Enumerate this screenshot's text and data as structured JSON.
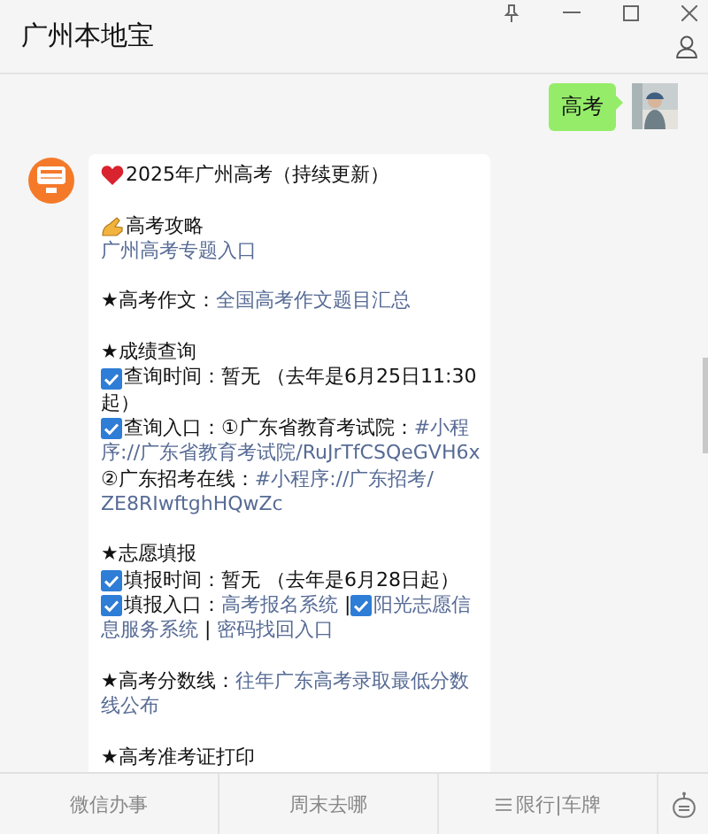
{
  "window": {
    "title": "广州本地宝"
  },
  "outgoing": {
    "text": "高考"
  },
  "incoming": {
    "lines": [
      {
        "space_before": false,
        "parts": [
          {
            "kind": "heart"
          },
          {
            "kind": "text",
            "text": "2025年广州高考（持续更新）"
          }
        ]
      },
      {
        "space_before": true,
        "parts": [
          {
            "kind": "hand"
          },
          {
            "kind": "text",
            "text": "高考攻略"
          }
        ]
      },
      {
        "space_before": false,
        "parts": [
          {
            "kind": "link",
            "text": "广州高考专题入口"
          }
        ]
      },
      {
        "space_before": true,
        "parts": [
          {
            "kind": "text",
            "text": "★高考作文："
          },
          {
            "kind": "link",
            "text": "全国高考作文题目汇总"
          }
        ]
      },
      {
        "space_before": true,
        "parts": [
          {
            "kind": "text",
            "text": "★成绩查询"
          }
        ]
      },
      {
        "space_before": false,
        "parts": [
          {
            "kind": "check"
          },
          {
            "kind": "text",
            "text": "查询时间：暂无 （去年是6月25日11:30"
          }
        ]
      },
      {
        "space_before": false,
        "parts": [
          {
            "kind": "text",
            "text": "起）"
          }
        ]
      },
      {
        "space_before": false,
        "parts": [
          {
            "kind": "check"
          },
          {
            "kind": "text",
            "text": "查询入口：①广东省教育考试院："
          },
          {
            "kind": "link",
            "text": "#小程"
          }
        ]
      },
      {
        "space_before": false,
        "parts": [
          {
            "kind": "link",
            "text": "序://广东省教育考试院/RuJrTfCSQeGVH6x"
          }
        ]
      },
      {
        "space_before": false,
        "parts": [
          {
            "kind": "text",
            "text": "②广东招考在线："
          },
          {
            "kind": "link",
            "text": "#小程序://广东招考/"
          }
        ]
      },
      {
        "space_before": false,
        "parts": [
          {
            "kind": "link",
            "text": "ZE8RIwftghHQwZc"
          }
        ]
      },
      {
        "space_before": true,
        "parts": [
          {
            "kind": "text",
            "text": "★志愿填报"
          }
        ]
      },
      {
        "space_before": false,
        "parts": [
          {
            "kind": "check"
          },
          {
            "kind": "text",
            "text": "填报时间：暂无 （去年是6月28日起）"
          }
        ]
      },
      {
        "space_before": false,
        "parts": [
          {
            "kind": "check"
          },
          {
            "kind": "text",
            "text": "填报入口："
          },
          {
            "kind": "link",
            "text": "高考报名系统"
          },
          {
            "kind": "text",
            "text": " |"
          },
          {
            "kind": "check"
          },
          {
            "kind": "link",
            "text": "阳光志愿信"
          }
        ]
      },
      {
        "space_before": false,
        "parts": [
          {
            "kind": "link",
            "text": "息服务系统"
          },
          {
            "kind": "text",
            "text": " | "
          },
          {
            "kind": "link",
            "text": "密码找回入口"
          }
        ]
      },
      {
        "space_before": true,
        "parts": [
          {
            "kind": "text",
            "text": "★高考分数线："
          },
          {
            "kind": "link",
            "text": "往年广东高考录取最低分数"
          }
        ]
      },
      {
        "space_before": false,
        "parts": [
          {
            "kind": "link",
            "text": "线公布"
          }
        ]
      },
      {
        "space_before": true,
        "parts": [
          {
            "kind": "text",
            "text": "★高考准考证打印"
          }
        ]
      }
    ]
  },
  "menu": [
    {
      "kind": "plain",
      "label": "微信办事"
    },
    {
      "kind": "plain",
      "label": "周末去哪"
    },
    {
      "kind": "listed",
      "label": "限行|车牌"
    }
  ]
}
